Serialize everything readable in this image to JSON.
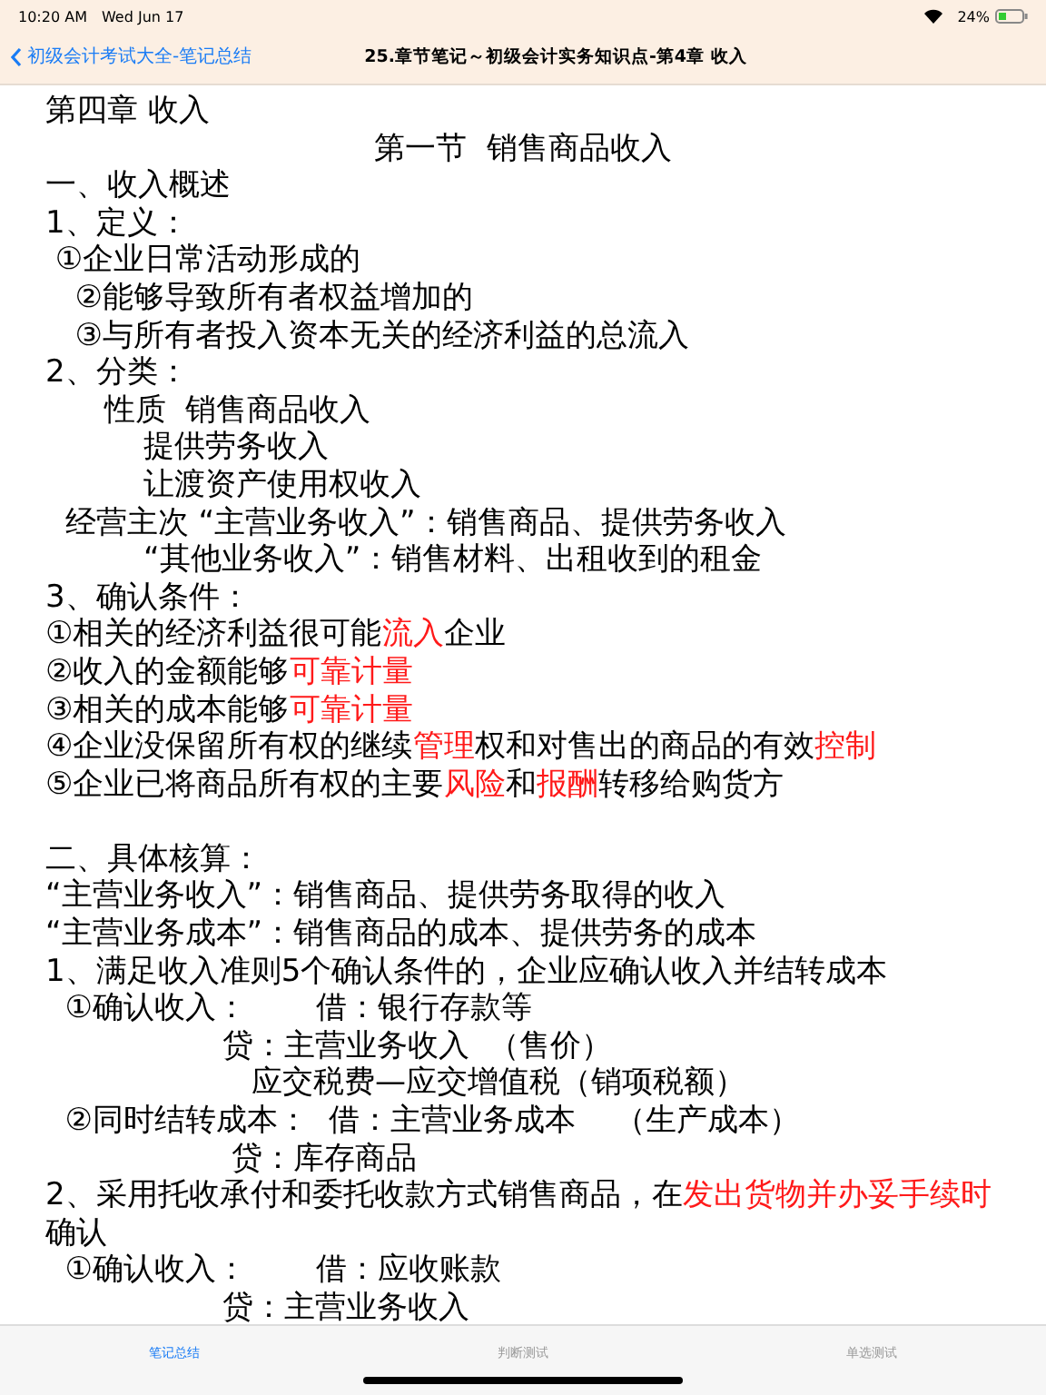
{
  "status_bar": {
    "time": "10:20 AM",
    "date": "Wed Jun 17",
    "battery": "24%"
  },
  "nav": {
    "back": "初级会计考试大全-笔记总结",
    "title": "25.章节笔记～初级会计实务知识点-第4章 收入"
  },
  "lines": [
    {
      "kind": "text",
      "segments": [
        {
          "text": "第四章 收入",
          "highlight": false
        }
      ]
    },
    {
      "kind": "heading",
      "segments": [
        {
          "text": "第一节  销售商品收入",
          "highlight": false
        }
      ]
    },
    {
      "kind": "text",
      "segments": [
        {
          "text": "一、收入概述",
          "highlight": false
        }
      ]
    },
    {
      "kind": "text",
      "segments": [
        {
          "text": "1、定义：",
          "highlight": false
        }
      ]
    },
    {
      "kind": "text",
      "segments": [
        {
          "text": " ①企业日常活动形成的",
          "highlight": false
        }
      ]
    },
    {
      "kind": "text",
      "segments": [
        {
          "text": "   ②能够导致所有者权益增加的",
          "highlight": false
        }
      ]
    },
    {
      "kind": "text",
      "segments": [
        {
          "text": "   ③与所有者投入资本无关的经济利益的总流入",
          "highlight": false
        }
      ]
    },
    {
      "kind": "text",
      "segments": [
        {
          "text": "2、分类：",
          "highlight": false
        }
      ]
    },
    {
      "kind": "text",
      "segments": [
        {
          "text": "      性质  销售商品收入",
          "highlight": false
        }
      ]
    },
    {
      "kind": "text",
      "segments": [
        {
          "text": "          提供劳务收入",
          "highlight": false
        }
      ]
    },
    {
      "kind": "text",
      "segments": [
        {
          "text": "          让渡资产使用权收入",
          "highlight": false
        }
      ]
    },
    {
      "kind": "text",
      "segments": [
        {
          "text": "  经营主次 “主营业务收入”：销售商品、提供劳务收入",
          "highlight": false
        }
      ]
    },
    {
      "kind": "text",
      "segments": [
        {
          "text": "          “其他业务收入”：销售材料、出租收到的租金",
          "highlight": false
        }
      ]
    },
    {
      "kind": "text",
      "segments": [
        {
          "text": "3、确认条件：",
          "highlight": false
        }
      ]
    },
    {
      "kind": "text",
      "segments": [
        {
          "text": "①相关的经济利益很可能",
          "highlight": false
        },
        {
          "text": "流入",
          "highlight": true
        },
        {
          "text": "企业",
          "highlight": false
        }
      ]
    },
    {
      "kind": "text",
      "segments": [
        {
          "text": "②收入的金额能够",
          "highlight": false
        },
        {
          "text": "可靠计量",
          "highlight": true
        }
      ]
    },
    {
      "kind": "text",
      "segments": [
        {
          "text": "③相关的成本能够",
          "highlight": false
        },
        {
          "text": "可靠计量",
          "highlight": true
        }
      ]
    },
    {
      "kind": "text",
      "segments": [
        {
          "text": "④企业没保留所有权的继续",
          "highlight": false
        },
        {
          "text": "管理",
          "highlight": true
        },
        {
          "text": "权和对售出的商品的有效",
          "highlight": false
        },
        {
          "text": "控制",
          "highlight": true
        }
      ]
    },
    {
      "kind": "text",
      "segments": [
        {
          "text": "⑤企业已将商品所有权的主要",
          "highlight": false
        },
        {
          "text": "风险",
          "highlight": true
        },
        {
          "text": "和",
          "highlight": false
        },
        {
          "text": "报酬",
          "highlight": true
        },
        {
          "text": "转移给购货方",
          "highlight": false
        }
      ]
    },
    {
      "kind": "blank"
    },
    {
      "kind": "text",
      "segments": [
        {
          "text": "二、具体核算：",
          "highlight": false
        }
      ]
    },
    {
      "kind": "text",
      "segments": [
        {
          "text": "“主营业务收入”：销售商品、提供劳务取得的收入",
          "highlight": false
        }
      ]
    },
    {
      "kind": "text",
      "segments": [
        {
          "text": "“主营业务成本”：销售商品的成本、提供劳务的成本",
          "highlight": false
        }
      ]
    },
    {
      "kind": "text",
      "segments": [
        {
          "text": "1、满足收入准则5个确认条件的，企业应确认收入并结转成本",
          "highlight": false
        }
      ]
    },
    {
      "kind": "text",
      "segments": [
        {
          "text": "  ①确认收入：       借：银行存款等",
          "highlight": false
        }
      ]
    },
    {
      "kind": "text",
      "segments": [
        {
          "text": "                  贷：主营业务收入  （售价）",
          "highlight": false
        }
      ]
    },
    {
      "kind": "text",
      "segments": [
        {
          "text": "                     应交税费—应交增值税（销项税额）",
          "highlight": false
        }
      ]
    },
    {
      "kind": "text",
      "segments": [
        {
          "text": "  ②同时结转成本：  借：主营业务成本    （生产成本）",
          "highlight": false
        }
      ]
    },
    {
      "kind": "text",
      "segments": [
        {
          "text": "                   贷：库存商品",
          "highlight": false
        }
      ]
    },
    {
      "kind": "text",
      "segments": [
        {
          "text": "2、采用托收承付和委托收款方式销售商品，在",
          "highlight": false
        },
        {
          "text": "发出货物并办妥手续时",
          "highlight": true
        }
      ]
    },
    {
      "kind": "text",
      "segments": [
        {
          "text": "确认",
          "highlight": false
        }
      ]
    },
    {
      "kind": "text",
      "segments": [
        {
          "text": "  ①确认收入：       借：应收账款",
          "highlight": false
        }
      ]
    },
    {
      "kind": "text",
      "segments": [
        {
          "text": "                  贷：主营业务收入",
          "highlight": false
        }
      ]
    }
  ],
  "tabs": [
    {
      "label": "笔记总结",
      "selected": true
    },
    {
      "label": "判断测试",
      "selected": false
    },
    {
      "label": "单选测试",
      "selected": false
    }
  ]
}
